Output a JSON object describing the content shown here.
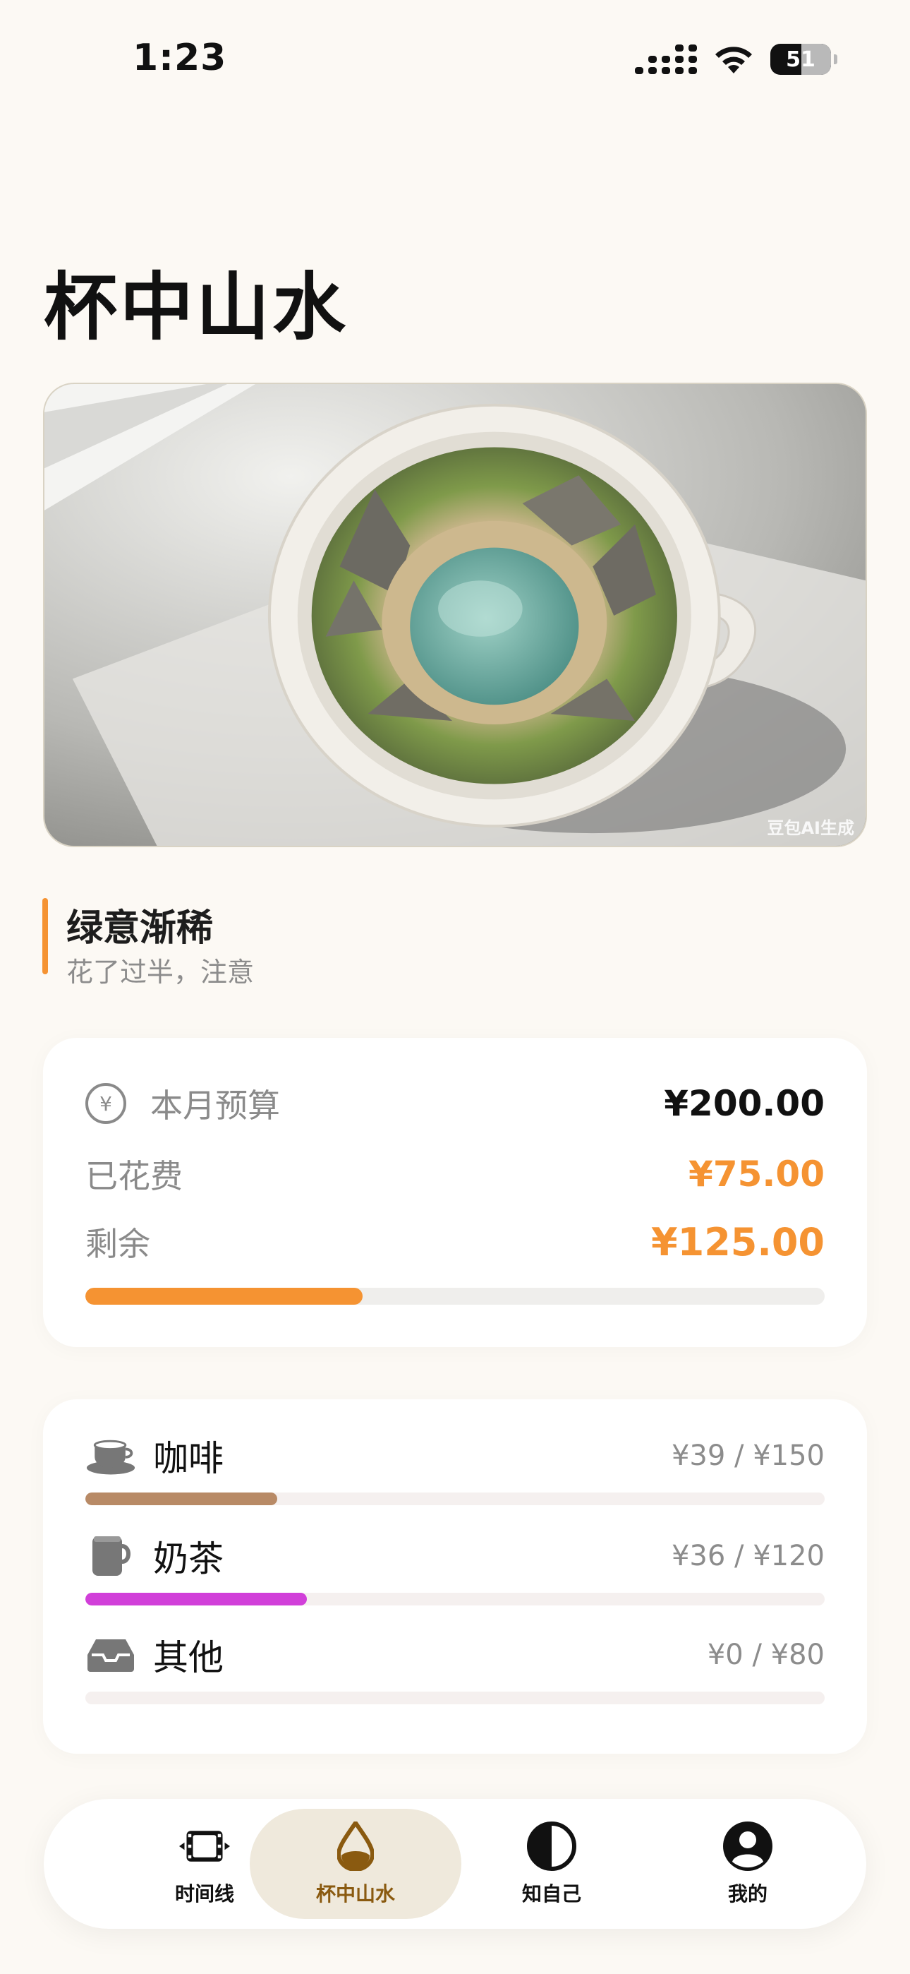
{
  "status_bar": {
    "time": "1:23",
    "battery": "51"
  },
  "page": {
    "title": "杯中山水"
  },
  "hero": {
    "watermark": "豆包AI生成"
  },
  "status": {
    "title": "绿意渐稀",
    "subtitle": "花了过半，注意"
  },
  "budget": {
    "icon": "yen-circle-icon",
    "monthly_label": "本月预算",
    "monthly_value": "¥200.00",
    "spent_label": "已花费",
    "spent_value": "¥75.00",
    "remaining_label": "剩余",
    "remaining_value": "¥125.00",
    "progress_fraction": 0.375,
    "accent_color": "#f59332"
  },
  "categories": [
    {
      "name": "咖啡",
      "amount": "¥39 / ¥150",
      "icon": "coffee-cup-icon",
      "fraction": 0.26,
      "color": "#b88a66"
    },
    {
      "name": "奶茶",
      "amount": "¥36 / ¥120",
      "icon": "mug-icon",
      "fraction": 0.3,
      "color": "#d13fd9"
    },
    {
      "name": "其他",
      "amount": "¥0 / ¥80",
      "icon": "tray-icon",
      "fraction": 0.0,
      "color": "#cccccc"
    }
  ],
  "tabs": [
    {
      "label": "时间线",
      "icon": "film-timeline-icon"
    },
    {
      "label": "杯中山水",
      "icon": "water-drop-icon",
      "active": true
    },
    {
      "label": "知自己",
      "icon": "half-circle-icon"
    },
    {
      "label": "我的",
      "icon": "person-icon"
    }
  ]
}
